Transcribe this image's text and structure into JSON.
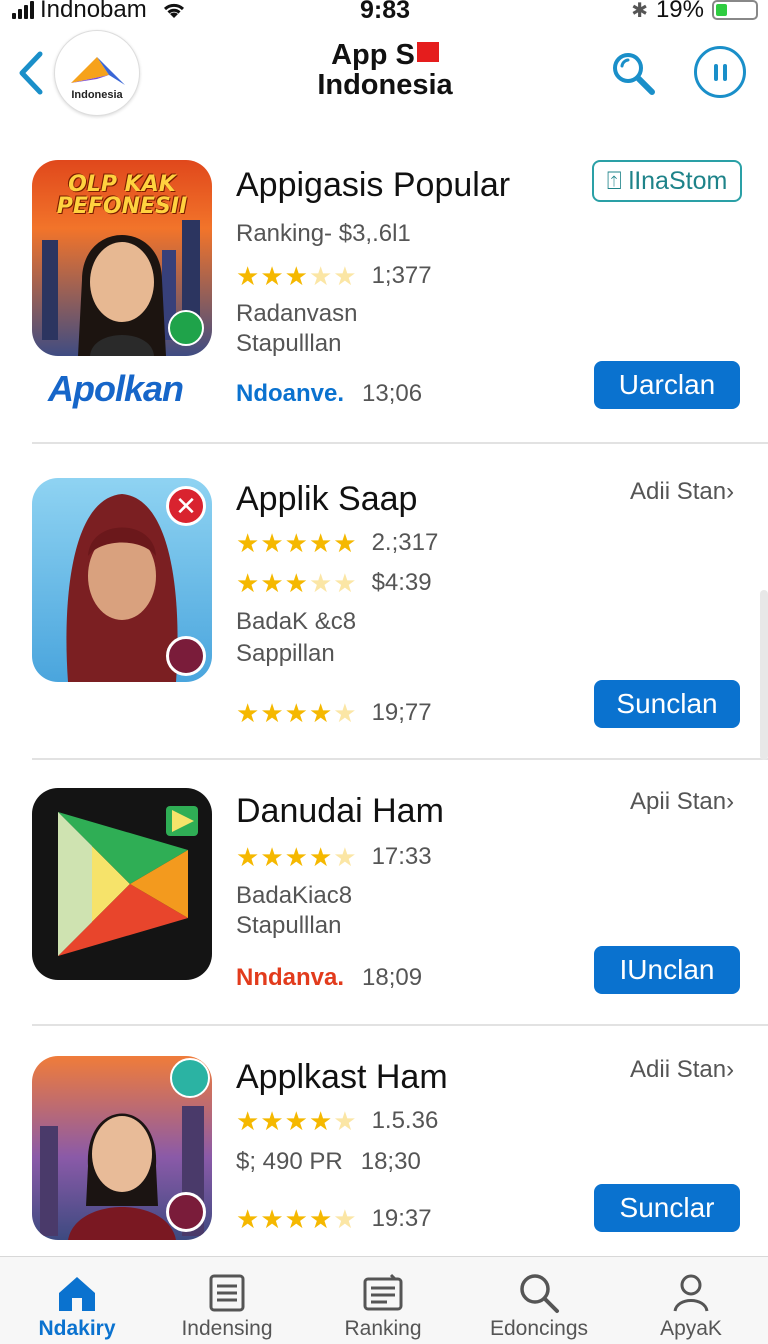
{
  "status_bar": {
    "carrier": "Indnobam",
    "time": "9:83",
    "battery": "19%",
    "battery_level": 0.3
  },
  "nav": {
    "logo_text": "Indonesia",
    "title_line1": "App S",
    "title_line2": "Indonesia"
  },
  "apps": [
    {
      "name": "Appigasis Popular",
      "icon_text": "OLP KAK PEFONESII",
      "line1": "Ranking- $3,.6l1",
      "rating_line": {
        "stars": 2.5,
        "text": "1;377"
      },
      "line3": "Radanvasn",
      "line4": "Stapulllan",
      "brand": "Apolkan",
      "publisher": "Ndoanve.",
      "publisher_color": "#0a72cf",
      "publisher_value": "13;06",
      "top_button": "lInaStom",
      "action": "Uarclan"
    },
    {
      "name": "Applik Saap",
      "side_link": "Adii Stan",
      "rating1": {
        "stars": 4.5,
        "text": "2.;317"
      },
      "rating2": {
        "stars": 2.5,
        "text": "$4:39"
      },
      "line3": "BadaK &c8",
      "line4": "Sappillan",
      "rating3": {
        "stars": 4,
        "text": "19;77"
      },
      "action": "Sunclan"
    },
    {
      "name": "Danudai Ham",
      "side_link": "Apii Stan",
      "rating1": {
        "stars": 3.5,
        "text": "17:33"
      },
      "line2": "BadaKiac8",
      "line3": "Stapulllan",
      "publisher": "Nndanva.",
      "publisher_color": "#e23b1c",
      "publisher_value": "18;09",
      "action": "IUnclan"
    },
    {
      "name": "Applkast Ham",
      "side_link": "Adii Stan",
      "rating1": {
        "stars": 4,
        "text": "1.5.36"
      },
      "line2": "$; 490 PR",
      "line2_value": "18;30",
      "rating3": {
        "stars": 4,
        "text": "19:37"
      },
      "action": "Sunclar"
    }
  ],
  "tabs": [
    {
      "label": "Ndakiry",
      "icon": "home-icon",
      "active": true
    },
    {
      "label": "Indensing",
      "icon": "list-icon",
      "active": false
    },
    {
      "label": "Ranking",
      "icon": "ranking-icon",
      "active": false
    },
    {
      "label": "Edoncings",
      "icon": "search-icon",
      "active": false
    },
    {
      "label": "ApyaK",
      "icon": "person-icon",
      "active": false
    }
  ],
  "colors": {
    "accent": "#0a72cf",
    "teal": "#1a8fc9",
    "star": "#f5b800"
  }
}
